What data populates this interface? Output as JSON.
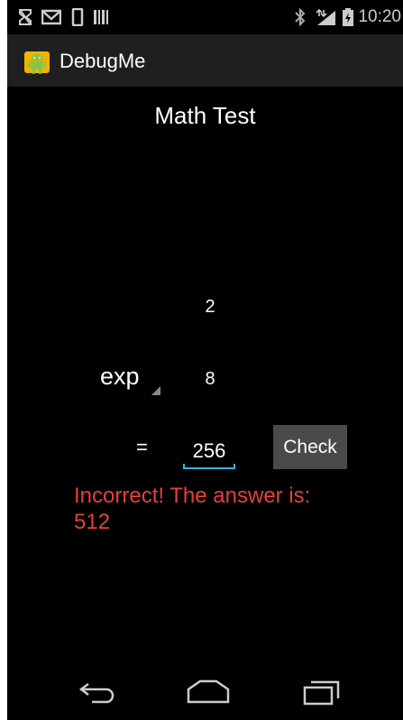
{
  "status_bar": {
    "time": "10:20",
    "left_icons": [
      "notification-block-icon",
      "mail-icon",
      "phone-icon",
      "barcode-icon"
    ],
    "right_icons": [
      "bluetooth-icon",
      "signal-icon",
      "battery-icon"
    ]
  },
  "action_bar": {
    "title": "DebugMe",
    "logo_icon": "android-robot-icon"
  },
  "page": {
    "title": "Math Test",
    "operand_1": "2",
    "operator": "exp",
    "operand_2": "8",
    "equals": "=",
    "answer_value": "256",
    "check_label": "Check",
    "result_line1": "Incorrect! The answer is:",
    "result_line2": "512"
  },
  "colors": {
    "background": "#000000",
    "action_bar": "#1f1f1f",
    "error_text": "#e63e3e",
    "accent": "#33b5e5",
    "button": "#4a4a4a"
  },
  "nav_bar": {
    "icons": [
      "back-icon",
      "home-icon",
      "recent-apps-icon"
    ]
  }
}
